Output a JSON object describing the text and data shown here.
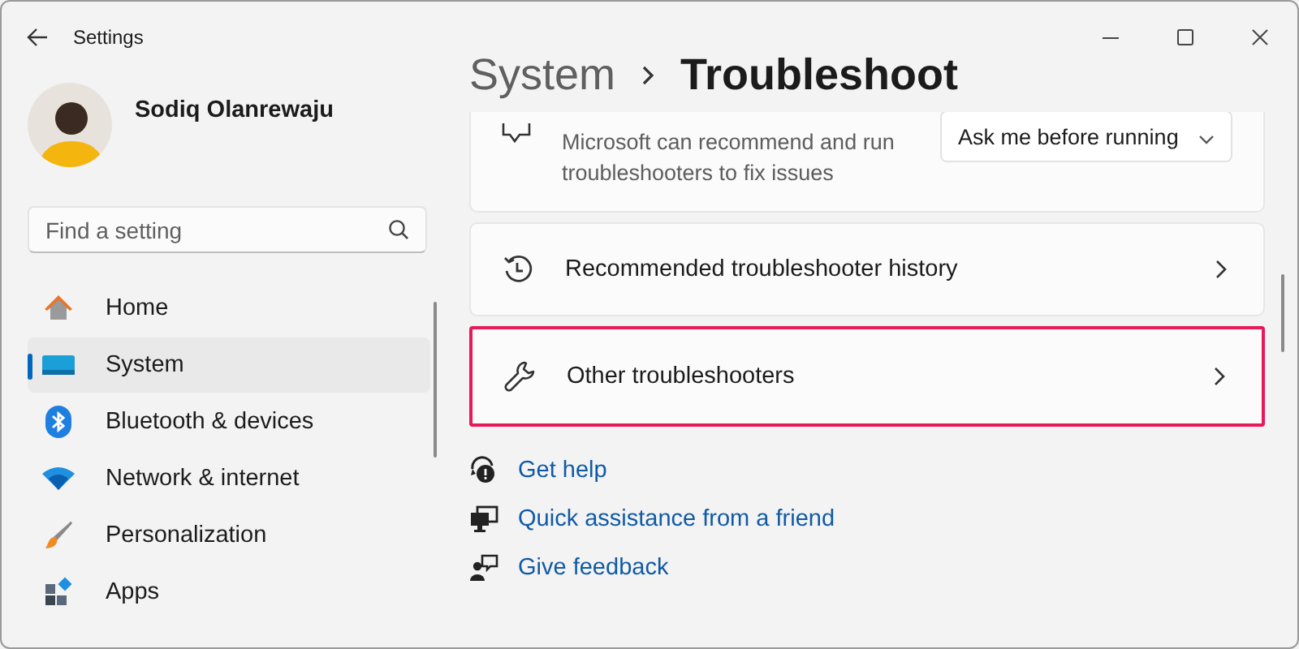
{
  "window": {
    "title": "Settings"
  },
  "user": {
    "name": "Sodiq Olanrewaju"
  },
  "search": {
    "placeholder": "Find a setting"
  },
  "nav": [
    {
      "label": "Home",
      "selected": false
    },
    {
      "label": "System",
      "selected": true
    },
    {
      "label": "Bluetooth & devices",
      "selected": false
    },
    {
      "label": "Network & internet",
      "selected": false
    },
    {
      "label": "Personalization",
      "selected": false
    },
    {
      "label": "Apps",
      "selected": false
    }
  ],
  "breadcrumb": {
    "parent": "System",
    "current": "Troubleshoot"
  },
  "cards": [
    {
      "kind": "dropdown",
      "description": "Microsoft can recommend and run troubleshooters to fix issues",
      "value": "Ask me before running",
      "highlighted": false
    },
    {
      "kind": "link",
      "label": "Recommended troubleshooter history",
      "highlighted": false
    },
    {
      "kind": "link",
      "label": "Other troubleshooters",
      "highlighted": true
    }
  ],
  "help_links": [
    {
      "label": "Get help"
    },
    {
      "label": "Quick assistance from a friend"
    },
    {
      "label": "Give feedback"
    }
  ]
}
